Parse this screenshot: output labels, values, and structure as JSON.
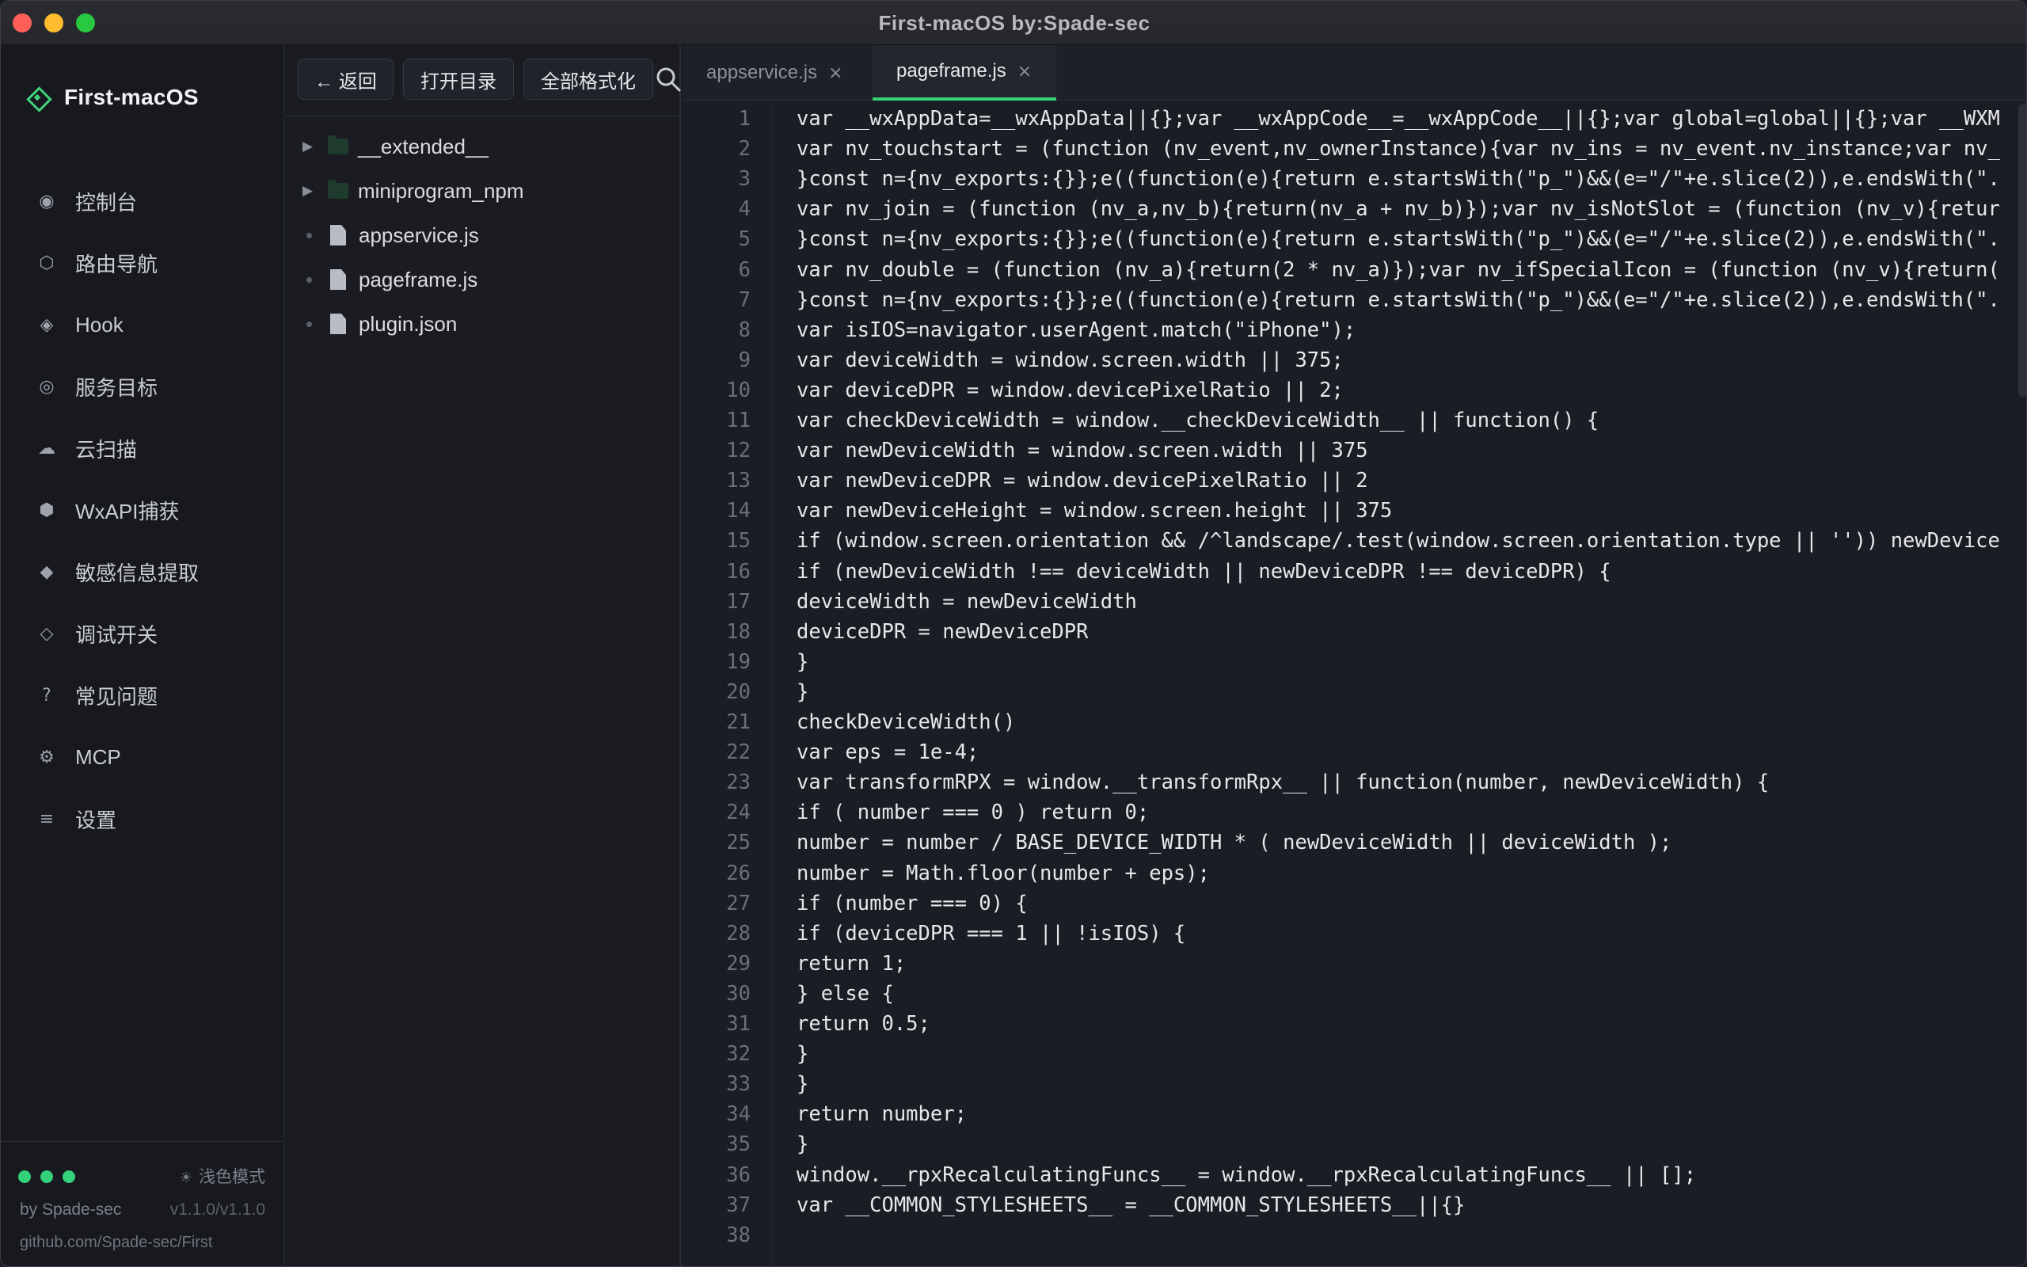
{
  "window": {
    "title": "First-macOS  by:Spade-sec"
  },
  "brand": {
    "name": "First-macOS"
  },
  "nav": [
    {
      "label": "控制台",
      "icon": "◉",
      "icon_name": "console-icon"
    },
    {
      "label": "路由导航",
      "icon": "⬡",
      "icon_name": "route-icon"
    },
    {
      "label": "Hook",
      "icon": "◈",
      "icon_name": "hook-icon"
    },
    {
      "label": "服务目标",
      "icon": "◎",
      "icon_name": "target-icon"
    },
    {
      "label": "云扫描",
      "icon": "☁",
      "icon_name": "cloud-icon"
    },
    {
      "label": "WxAPI捕获",
      "icon": "⬢",
      "icon_name": "capture-icon"
    },
    {
      "label": "敏感信息提取",
      "icon": "◆",
      "icon_name": "diamond-icon"
    },
    {
      "label": "调试开关",
      "icon": "◇",
      "icon_name": "debug-icon"
    },
    {
      "label": "常见问题",
      "icon": "?",
      "icon_name": "help-icon"
    },
    {
      "label": "MCP",
      "icon": "⚙",
      "icon_name": "mcp-icon"
    },
    {
      "label": "设置",
      "icon": "≡",
      "icon_name": "settings-icon"
    }
  ],
  "footer": {
    "theme_label": "浅色模式",
    "author": "by Spade-sec",
    "version": "v1.1.0/v1.1.0",
    "repo": "github.com/Spade-sec/First"
  },
  "toolbar": {
    "back_label": "← 返回",
    "open_dir_label": "打开目录",
    "format_all_label": "全部格式化"
  },
  "tree": [
    {
      "type": "folder",
      "name": "__extended__"
    },
    {
      "type": "folder",
      "name": "miniprogram_npm"
    },
    {
      "type": "file",
      "name": "appservice.js"
    },
    {
      "type": "file",
      "name": "pageframe.js"
    },
    {
      "type": "file",
      "name": "plugin.json"
    }
  ],
  "tabs": [
    {
      "label": "appservice.js",
      "active": false
    },
    {
      "label": "pageframe.js",
      "active": true
    }
  ],
  "colors": {
    "accent": "#33d17a",
    "background": "#1b1d24"
  },
  "code_lines": [
    "var __wxAppData=__wxAppData||{};var __wxAppCode__=__wxAppCode__||{};var global=global||{};var __WXM",
    "var nv_touchstart = (function (nv_event,nv_ownerInstance){var nv_ins = nv_event.nv_instance;var nv_",
    "}const n={nv_exports:{}};e((function(e){return e.startsWith(\"p_\")&&(e=\"/\"+e.slice(2)),e.endsWith(\".",
    "var nv_join = (function (nv_a,nv_b){return(nv_a + nv_b)});var nv_isNotSlot = (function (nv_v){retur",
    "}const n={nv_exports:{}};e((function(e){return e.startsWith(\"p_\")&&(e=\"/\"+e.slice(2)),e.endsWith(\".",
    "var nv_double = (function (nv_a){return(2 * nv_a)});var nv_ifSpecialIcon = (function (nv_v){return(",
    "}const n={nv_exports:{}};e((function(e){return e.startsWith(\"p_\")&&(e=\"/\"+e.slice(2)),e.endsWith(\".",
    "var isIOS=navigator.userAgent.match(\"iPhone\");",
    "var deviceWidth = window.screen.width || 375;",
    "var deviceDPR = window.devicePixelRatio || 2;",
    "var checkDeviceWidth = window.__checkDeviceWidth__ || function() {",
    "var newDeviceWidth = window.screen.width || 375",
    "var newDeviceDPR = window.devicePixelRatio || 2",
    "var newDeviceHeight = window.screen.height || 375",
    "if (window.screen.orientation && /^landscape/.test(window.screen.orientation.type || '')) newDevice",
    "if (newDeviceWidth !== deviceWidth || newDeviceDPR !== deviceDPR) {",
    "deviceWidth = newDeviceWidth",
    "deviceDPR = newDeviceDPR",
    "}",
    "}",
    "checkDeviceWidth()",
    "var eps = 1e-4;",
    "var transformRPX = window.__transformRpx__ || function(number, newDeviceWidth) {",
    "if ( number === 0 ) return 0;",
    "number = number / BASE_DEVICE_WIDTH * ( newDeviceWidth || deviceWidth );",
    "number = Math.floor(number + eps);",
    "if (number === 0) {",
    "if (deviceDPR === 1 || !isIOS) {",
    "return 1;",
    "} else {",
    "return 0.5;",
    "}",
    "}",
    "return number;",
    "}",
    "window.__rpxRecalculatingFuncs__ = window.__rpxRecalculatingFuncs__ || [];",
    "var __COMMON_STYLESHEETS__ = __COMMON_STYLESHEETS__||{}",
    ""
  ]
}
